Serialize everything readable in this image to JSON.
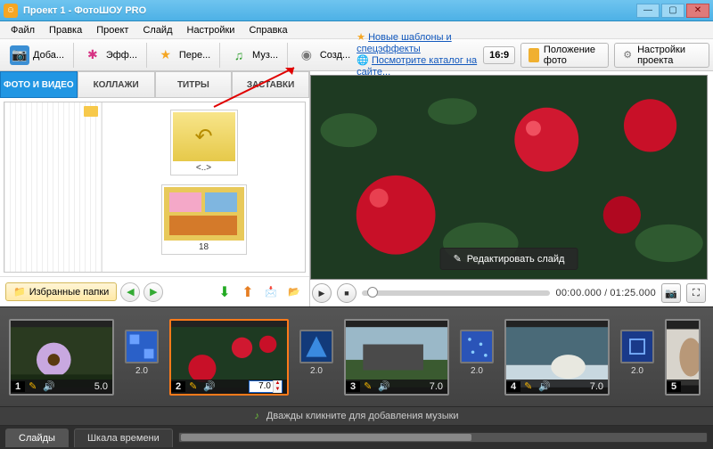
{
  "window": {
    "title": "Проект 1 - ФотоШОУ PRO"
  },
  "menu": [
    "Файл",
    "Правка",
    "Проект",
    "Слайд",
    "Настройки",
    "Справка"
  ],
  "toolbar": {
    "add": "Доба...",
    "effects": "Эфф...",
    "transitions": "Пере...",
    "music": "Муз...",
    "create": "Созд..."
  },
  "promo": {
    "line1": "Новые шаблоны и спецэффекты",
    "line2": "Посмотрите каталог на сайте..."
  },
  "ratio": "16:9",
  "btn_position": "Положение фото",
  "btn_project_settings": "Настройки проекта",
  "tabs": {
    "photo": "ФОТО И ВИДЕО",
    "collage": "КОЛЛАЖИ",
    "titles": "ТИТРЫ",
    "splash": "ЗАСТАВКИ"
  },
  "browser": {
    "items": [
      {
        "label": "<..>"
      },
      {
        "label": "18"
      }
    ],
    "favorites": "Избранные папки"
  },
  "preview": {
    "edit": "Редактировать слайд"
  },
  "player": {
    "elapsed": "00:00.000",
    "total": "01:25.000"
  },
  "timeline": {
    "slides": [
      {
        "n": "1",
        "dur": "5.0"
      },
      {
        "n": "2",
        "dur": "7.0"
      },
      {
        "n": "3",
        "dur": "7.0"
      },
      {
        "n": "4",
        "dur": "7.0"
      },
      {
        "n": "5"
      }
    ],
    "trans": [
      "2.0",
      "2.0",
      "2.0",
      "2.0"
    ],
    "music_hint": "Дважды кликните для добавления музыки"
  },
  "bottom_tabs": {
    "slides": "Слайды",
    "timescale": "Шкала времени"
  }
}
